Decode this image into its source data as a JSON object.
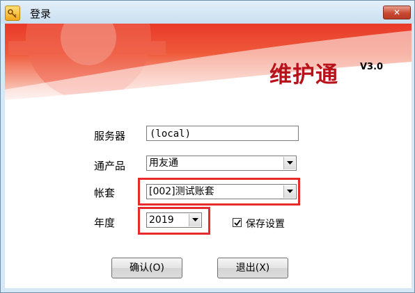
{
  "window": {
    "title": "登录",
    "close_label": "✕"
  },
  "banner": {
    "brand": "维护通",
    "version": "V3.0"
  },
  "form": {
    "server_label": "服务器",
    "server_value": "(local)",
    "product_label": "通产品",
    "product_value": "用友通",
    "account_label": "帐套",
    "account_value": "[002]测试账套",
    "year_label": "年度",
    "year_value": "2019",
    "save_settings_label": "保存设置",
    "save_settings_checked": true
  },
  "buttons": {
    "confirm_label": "确认(O)",
    "exit_label": "退出(X)"
  },
  "colors": {
    "highlight": "#e52b2b",
    "banner_red": "#e83a2a",
    "brand_red": "#b8121b"
  }
}
